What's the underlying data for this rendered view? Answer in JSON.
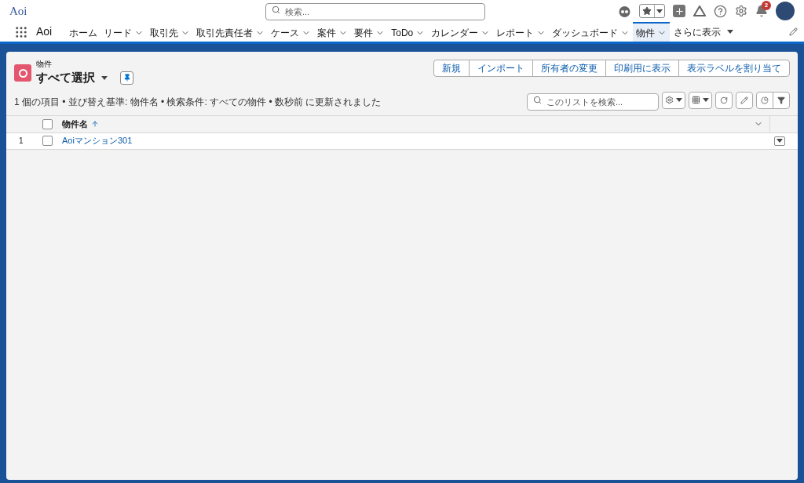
{
  "header": {
    "logo_text": "Aoi",
    "search_placeholder": "検索...",
    "notification_count": "2"
  },
  "nav": {
    "app_name": "Aoi",
    "items": [
      {
        "label": "ホーム",
        "dropdown": false,
        "selected": false
      },
      {
        "label": "リード",
        "dropdown": true,
        "selected": false
      },
      {
        "label": "取引先",
        "dropdown": true,
        "selected": false
      },
      {
        "label": "取引先責任者",
        "dropdown": true,
        "selected": false
      },
      {
        "label": "ケース",
        "dropdown": true,
        "selected": false
      },
      {
        "label": "案件",
        "dropdown": true,
        "selected": false
      },
      {
        "label": "要件",
        "dropdown": true,
        "selected": false
      },
      {
        "label": "ToDo",
        "dropdown": true,
        "selected": false
      },
      {
        "label": "カレンダー",
        "dropdown": true,
        "selected": false
      },
      {
        "label": "レポート",
        "dropdown": true,
        "selected": false
      },
      {
        "label": "ダッシュボード",
        "dropdown": true,
        "selected": false
      },
      {
        "label": "物件",
        "dropdown": true,
        "selected": true
      }
    ],
    "more": "さらに表示"
  },
  "list_view": {
    "object_label": "物件",
    "title": "すべて選択",
    "actions": [
      "新規",
      "インポート",
      "所有者の変更",
      "印刷用に表示",
      "表示ラベルを割り当て"
    ],
    "search_placeholder": "このリストを検索...",
    "status": "1 個の項目 • 並び替え基準: 物件名 • 検索条件: すべての物件 • 数秒前 に更新されました",
    "select_all_checked": false,
    "columns": [
      "物件名"
    ],
    "rows": [
      {
        "number": "1",
        "name": "Aoiマンション301",
        "checked": false
      }
    ]
  }
}
